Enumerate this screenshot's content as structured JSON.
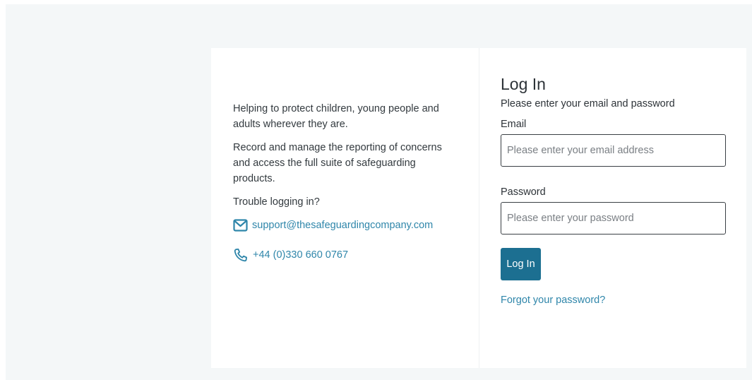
{
  "intro": {
    "tagline": "Helping to protect children, young people and adults wherever they are.",
    "description": "Record and manage the reporting of concerns and access the full suite of safeguarding products.",
    "trouble_text": "Trouble logging in?"
  },
  "contact": {
    "email": "support@thesafeguardingcompany.com",
    "email_icon": "envelope-icon",
    "phone": "+44 (0)330 660 0767",
    "phone_icon": "phone-icon"
  },
  "login": {
    "title": "Log In",
    "subtitle": "Please enter your email and password",
    "email_label": "Email",
    "email_placeholder": "Please enter your email address",
    "email_value": "",
    "password_label": "Password",
    "password_placeholder": "Please enter your password",
    "password_value": "",
    "submit_label": "Log In",
    "forgot_label": "Forgot your password?"
  },
  "colors": {
    "accent": "#1c6f91",
    "link": "#2f86aa",
    "background": "#f4f7f8"
  }
}
